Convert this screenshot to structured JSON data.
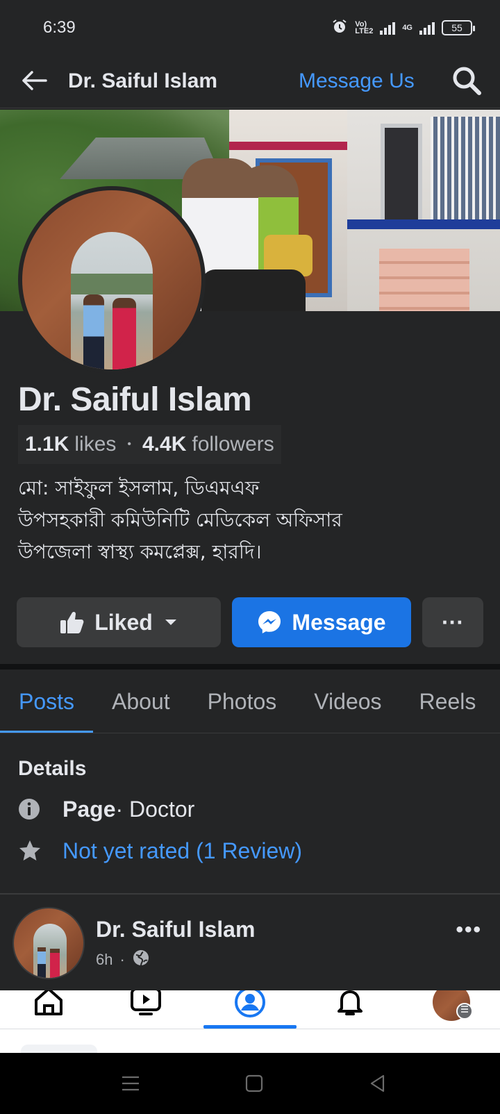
{
  "status_bar": {
    "time": "6:39",
    "volte_label_top": "Vo)",
    "volte_label_bottom": "LTE2",
    "network_label": "4G",
    "battery": "55"
  },
  "app_bar": {
    "title": "Dr. Saiful Islam",
    "message_us": "Message Us",
    "back_icon": "arrow-left-icon",
    "search_icon": "search-icon"
  },
  "profile": {
    "name": "Dr. Saiful Islam",
    "likes_count": "1.1K",
    "likes_label": "likes",
    "followers_count": "4.4K",
    "followers_label": "followers",
    "bio_lines": [
      "মো: সাইফুল ইসলাম, ডিএমএফ",
      "উপসহকারী কমিউনিটি মেডিকেল অফিসার",
      "উপজেলা স্বাস্থ্য কমপ্লেক্স, হারদি।"
    ]
  },
  "actions": {
    "liked_label": "Liked",
    "message_label": "Message",
    "more_label": "···"
  },
  "tabs": [
    {
      "label": "Posts",
      "active": true
    },
    {
      "label": "About",
      "active": false
    },
    {
      "label": "Photos",
      "active": false
    },
    {
      "label": "Videos",
      "active": false
    },
    {
      "label": "Reels",
      "active": false
    }
  ],
  "details": {
    "title": "Details",
    "page_label": "Page",
    "category": " · Doctor",
    "rating": "Not yet rated (1 Review)"
  },
  "post": {
    "author": "Dr. Saiful Islam",
    "time": "6h",
    "more_label": "•••"
  },
  "bottom_nav": [
    "home-icon",
    "video-icon",
    "profile-icon",
    "bell-icon",
    "menu-avatar"
  ],
  "system_nav": [
    "recent-apps-icon",
    "home-square-icon",
    "back-triangle-icon"
  ],
  "colors": {
    "background": "#242526",
    "accent": "#4599ff",
    "message_button": "#1b74e4",
    "secondary_button": "#3a3b3c"
  }
}
